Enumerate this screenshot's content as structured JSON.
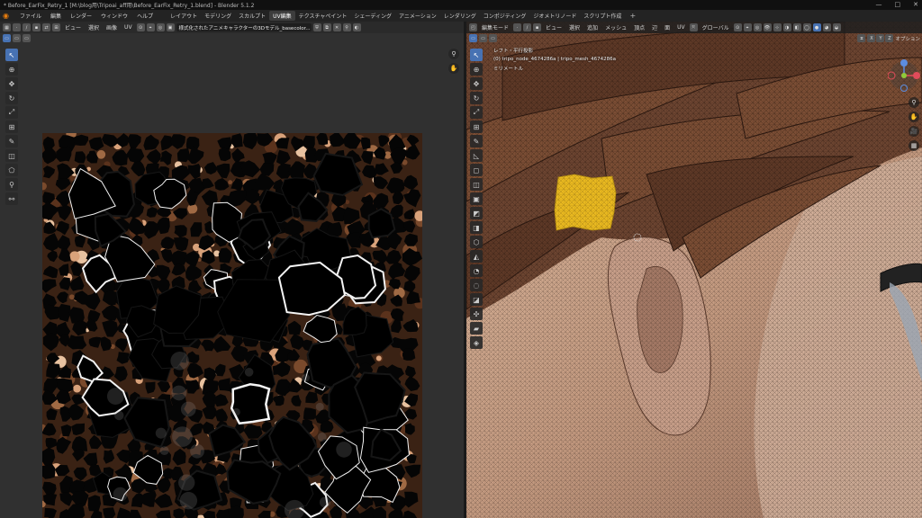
{
  "window": {
    "title": "* Before_EarFix_Retry_1 [M:\\blog用\\Tripoai_aff用\\Before_EarFix_Retry_1.blend] - Blender 5.1.2",
    "controls": [
      "—",
      "□",
      "✕"
    ]
  },
  "menubar": {
    "menus": [
      "ファイル",
      "編集",
      "レンダー",
      "ウィンドウ",
      "ヘルプ"
    ],
    "workspaces": [
      "レイアウト",
      "モデリング",
      "スカルプト",
      "UV編集",
      "テクスチャペイント",
      "シェーディング",
      "アニメーション",
      "レンダリング",
      "コンポジティング",
      "ジオメトリノード",
      "スクリプト作成"
    ],
    "active_workspace": "UV編集",
    "add_label": "+"
  },
  "uv_editor": {
    "menus": [
      "ビュー",
      "選択",
      "画像",
      "UV"
    ],
    "image_name": "様式化されたアニメキャラクターの3Dモデル_basecolor...",
    "colors": {
      "background": "#303030",
      "active_tool": "#4772b3"
    }
  },
  "viewport": {
    "mode_label": "編集モード",
    "menus": [
      "ビュー",
      "選択",
      "追加",
      "メッシュ",
      "頂点",
      "辺",
      "面",
      "UV"
    ],
    "transform_orientation": "グローバル",
    "overlay_info": {
      "view_name": "レフト・平行投影",
      "object_line": "(0) tripo_node_4674286a | tripo_mesh_4674286a",
      "unit_line": "ミリメートル"
    },
    "axis_buttons": [
      "X",
      "Y",
      "Z"
    ],
    "options_label": "オプション",
    "colors": {
      "hair": "#6b4430",
      "skin": "#c9a58c",
      "selection": "#e8b820"
    }
  }
}
